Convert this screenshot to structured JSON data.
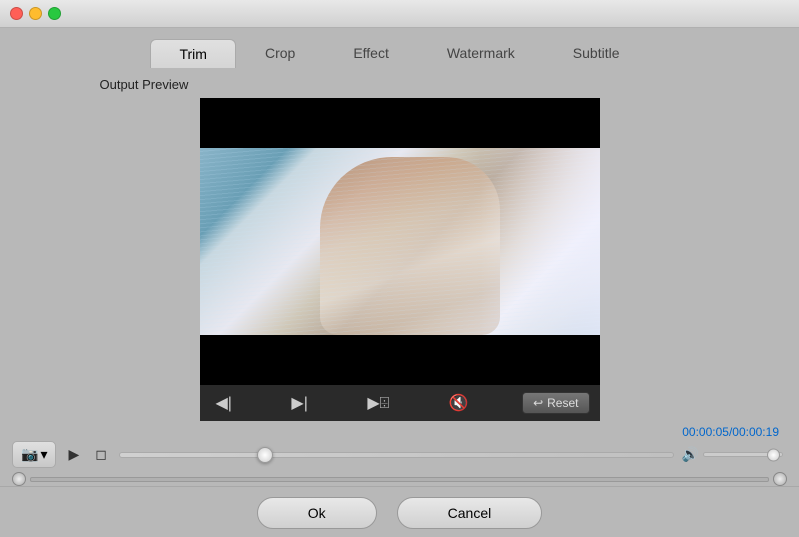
{
  "titlebar": {
    "traffic_lights": [
      "close",
      "minimize",
      "maximize"
    ]
  },
  "tabs": [
    {
      "id": "trim",
      "label": "Trim",
      "active": true
    },
    {
      "id": "crop",
      "label": "Crop",
      "active": false
    },
    {
      "id": "effect",
      "label": "Effect",
      "active": false
    },
    {
      "id": "watermark",
      "label": "Watermark",
      "active": false
    },
    {
      "id": "subtitle",
      "label": "Subtitle",
      "active": false
    }
  ],
  "output_preview_label": "Output Preview",
  "transport": {
    "btn_prev_frame": "◀|",
    "btn_play_pause": "▶|",
    "btn_next_frame": "▶[",
    "btn_mute": "🔇",
    "btn_reset_label": "Reset"
  },
  "playback": {
    "current_time": "00:00:05",
    "total_time": "00:00:19",
    "time_separator": "/"
  },
  "controls": {
    "camera_icon": "📷",
    "camera_dropdown": "▾",
    "play_icon": "▶",
    "stop_icon": "◻"
  },
  "buttons": {
    "ok_label": "Ok",
    "cancel_label": "Cancel"
  }
}
